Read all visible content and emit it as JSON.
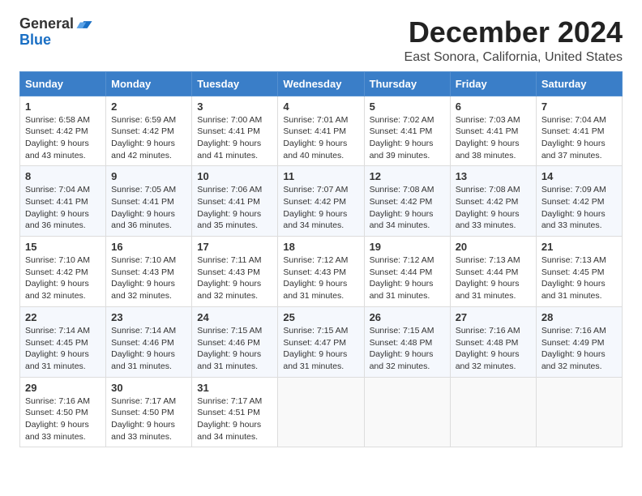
{
  "header": {
    "logo_line1": "General",
    "logo_line2": "Blue",
    "main_title": "December 2024",
    "subtitle": "East Sonora, California, United States"
  },
  "calendar": {
    "days_of_week": [
      "Sunday",
      "Monday",
      "Tuesday",
      "Wednesday",
      "Thursday",
      "Friday",
      "Saturday"
    ],
    "weeks": [
      [
        {
          "day": "1",
          "info": "Sunrise: 6:58 AM\nSunset: 4:42 PM\nDaylight: 9 hours\nand 43 minutes."
        },
        {
          "day": "2",
          "info": "Sunrise: 6:59 AM\nSunset: 4:42 PM\nDaylight: 9 hours\nand 42 minutes."
        },
        {
          "day": "3",
          "info": "Sunrise: 7:00 AM\nSunset: 4:41 PM\nDaylight: 9 hours\nand 41 minutes."
        },
        {
          "day": "4",
          "info": "Sunrise: 7:01 AM\nSunset: 4:41 PM\nDaylight: 9 hours\nand 40 minutes."
        },
        {
          "day": "5",
          "info": "Sunrise: 7:02 AM\nSunset: 4:41 PM\nDaylight: 9 hours\nand 39 minutes."
        },
        {
          "day": "6",
          "info": "Sunrise: 7:03 AM\nSunset: 4:41 PM\nDaylight: 9 hours\nand 38 minutes."
        },
        {
          "day": "7",
          "info": "Sunrise: 7:04 AM\nSunset: 4:41 PM\nDaylight: 9 hours\nand 37 minutes."
        }
      ],
      [
        {
          "day": "8",
          "info": "Sunrise: 7:04 AM\nSunset: 4:41 PM\nDaylight: 9 hours\nand 36 minutes."
        },
        {
          "day": "9",
          "info": "Sunrise: 7:05 AM\nSunset: 4:41 PM\nDaylight: 9 hours\nand 36 minutes."
        },
        {
          "day": "10",
          "info": "Sunrise: 7:06 AM\nSunset: 4:41 PM\nDaylight: 9 hours\nand 35 minutes."
        },
        {
          "day": "11",
          "info": "Sunrise: 7:07 AM\nSunset: 4:42 PM\nDaylight: 9 hours\nand 34 minutes."
        },
        {
          "day": "12",
          "info": "Sunrise: 7:08 AM\nSunset: 4:42 PM\nDaylight: 9 hours\nand 34 minutes."
        },
        {
          "day": "13",
          "info": "Sunrise: 7:08 AM\nSunset: 4:42 PM\nDaylight: 9 hours\nand 33 minutes."
        },
        {
          "day": "14",
          "info": "Sunrise: 7:09 AM\nSunset: 4:42 PM\nDaylight: 9 hours\nand 33 minutes."
        }
      ],
      [
        {
          "day": "15",
          "info": "Sunrise: 7:10 AM\nSunset: 4:42 PM\nDaylight: 9 hours\nand 32 minutes."
        },
        {
          "day": "16",
          "info": "Sunrise: 7:10 AM\nSunset: 4:43 PM\nDaylight: 9 hours\nand 32 minutes."
        },
        {
          "day": "17",
          "info": "Sunrise: 7:11 AM\nSunset: 4:43 PM\nDaylight: 9 hours\nand 32 minutes."
        },
        {
          "day": "18",
          "info": "Sunrise: 7:12 AM\nSunset: 4:43 PM\nDaylight: 9 hours\nand 31 minutes."
        },
        {
          "day": "19",
          "info": "Sunrise: 7:12 AM\nSunset: 4:44 PM\nDaylight: 9 hours\nand 31 minutes."
        },
        {
          "day": "20",
          "info": "Sunrise: 7:13 AM\nSunset: 4:44 PM\nDaylight: 9 hours\nand 31 minutes."
        },
        {
          "day": "21",
          "info": "Sunrise: 7:13 AM\nSunset: 4:45 PM\nDaylight: 9 hours\nand 31 minutes."
        }
      ],
      [
        {
          "day": "22",
          "info": "Sunrise: 7:14 AM\nSunset: 4:45 PM\nDaylight: 9 hours\nand 31 minutes."
        },
        {
          "day": "23",
          "info": "Sunrise: 7:14 AM\nSunset: 4:46 PM\nDaylight: 9 hours\nand 31 minutes."
        },
        {
          "day": "24",
          "info": "Sunrise: 7:15 AM\nSunset: 4:46 PM\nDaylight: 9 hours\nand 31 minutes."
        },
        {
          "day": "25",
          "info": "Sunrise: 7:15 AM\nSunset: 4:47 PM\nDaylight: 9 hours\nand 31 minutes."
        },
        {
          "day": "26",
          "info": "Sunrise: 7:15 AM\nSunset: 4:48 PM\nDaylight: 9 hours\nand 32 minutes."
        },
        {
          "day": "27",
          "info": "Sunrise: 7:16 AM\nSunset: 4:48 PM\nDaylight: 9 hours\nand 32 minutes."
        },
        {
          "day": "28",
          "info": "Sunrise: 7:16 AM\nSunset: 4:49 PM\nDaylight: 9 hours\nand 32 minutes."
        }
      ],
      [
        {
          "day": "29",
          "info": "Sunrise: 7:16 AM\nSunset: 4:50 PM\nDaylight: 9 hours\nand 33 minutes."
        },
        {
          "day": "30",
          "info": "Sunrise: 7:17 AM\nSunset: 4:50 PM\nDaylight: 9 hours\nand 33 minutes."
        },
        {
          "day": "31",
          "info": "Sunrise: 7:17 AM\nSunset: 4:51 PM\nDaylight: 9 hours\nand 34 minutes."
        },
        {
          "day": "",
          "info": ""
        },
        {
          "day": "",
          "info": ""
        },
        {
          "day": "",
          "info": ""
        },
        {
          "day": "",
          "info": ""
        }
      ]
    ]
  }
}
